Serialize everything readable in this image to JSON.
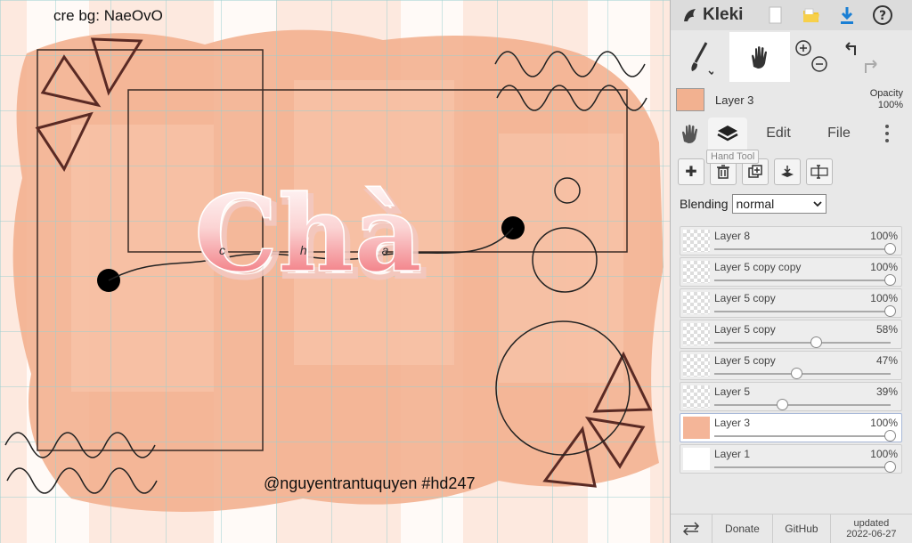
{
  "canvas": {
    "credit_text": "cre bg: NaeOvO",
    "watermark_text": "@nguyentrantuquyen  #hd247",
    "title_script": "Chà",
    "small_script": "c h a"
  },
  "app": {
    "logo_text": "Kleki"
  },
  "toolbar": {
    "brush_icon": "brush-icon",
    "hand_icon": "hand-icon"
  },
  "current_layer": {
    "name": "Layer 3",
    "opacity_label": "Opacity",
    "opacity_value": "100%"
  },
  "tabs": {
    "edit": "Edit",
    "file": "File"
  },
  "tooltip": "Hand Tool",
  "blending": {
    "label": "Blending",
    "value": "normal"
  },
  "layers": [
    {
      "name": "Layer 8",
      "opacity": "100%",
      "level": 1.0
    },
    {
      "name": "Layer 5 copy copy",
      "opacity": "100%",
      "level": 1.0
    },
    {
      "name": "Layer 5 copy",
      "opacity": "100%",
      "level": 1.0
    },
    {
      "name": "Layer 5 copy",
      "opacity": "58%",
      "level": 0.58
    },
    {
      "name": "Layer 5 copy",
      "opacity": "47%",
      "level": 0.47
    },
    {
      "name": "Layer 5",
      "opacity": "39%",
      "level": 0.39
    },
    {
      "name": "Layer 3",
      "opacity": "100%",
      "level": 1.0
    },
    {
      "name": "Layer 1",
      "opacity": "100%",
      "level": 1.0
    }
  ],
  "footer": {
    "donate": "Donate",
    "github": "GitHub",
    "updated_label": "updated",
    "updated_date": "2022-06-27"
  },
  "colors": {
    "peach": "#f4b598",
    "accent": "#f06a72",
    "panel": "#e8e8e8"
  }
}
